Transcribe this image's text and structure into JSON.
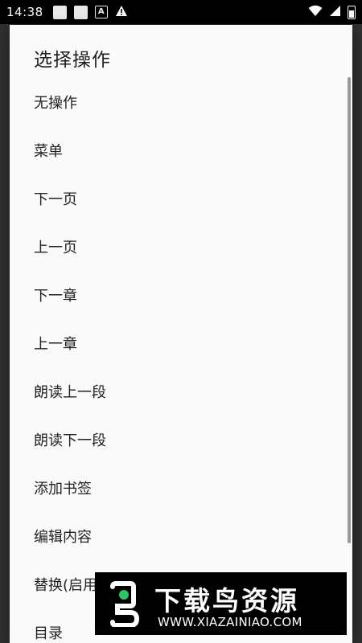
{
  "status_bar": {
    "time": "14:38",
    "a_icon_letter": "A",
    "warning_glyph": "▲"
  },
  "dialog": {
    "title": "选择操作",
    "items": [
      {
        "label": "无操作"
      },
      {
        "label": "菜单"
      },
      {
        "label": "下一页"
      },
      {
        "label": "上一页"
      },
      {
        "label": "下一章"
      },
      {
        "label": "上一章"
      },
      {
        "label": "朗读上一段"
      },
      {
        "label": "朗读下一段"
      },
      {
        "label": "添加书签"
      },
      {
        "label": "编辑内容"
      },
      {
        "label": "替换(启用"
      },
      {
        "label": "目录"
      }
    ]
  },
  "watermark": {
    "title": "下载鸟资源",
    "url": "WWW.XIAZAINIAO.COM"
  }
}
